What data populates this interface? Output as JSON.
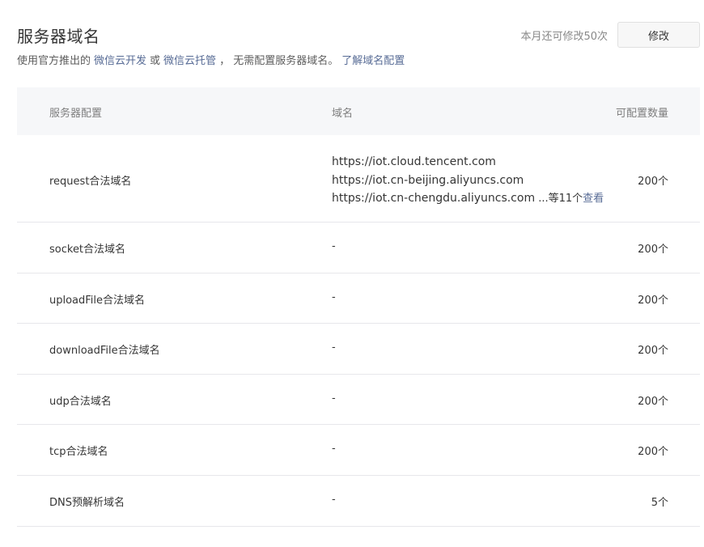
{
  "header": {
    "title": "服务器域名",
    "subtitle_prefix": "使用官方推出的",
    "link_cloud_dev": "微信云开发",
    "subtitle_or": "或",
    "link_cloud_hosting": "微信云托管",
    "subtitle_suffix": "，  无需配置服务器域名。",
    "link_learn": "了解域名配置",
    "quota_text": "本月还可修改50次",
    "modify_label": "修改"
  },
  "table": {
    "columns": [
      "服务器配置",
      "域名",
      "可配置数量"
    ],
    "rows": [
      {
        "name": "request合法域名",
        "domains": [
          "https://iot.cloud.tencent.com",
          "https://iot.cn-beijing.aliyuncs.com",
          "https://iot.cn-chengdu.aliyuncs.com"
        ],
        "more": " ...等11个",
        "view": "查看",
        "count": "200个"
      },
      {
        "name": "socket合法域名",
        "domain": "-",
        "count": "200个"
      },
      {
        "name": "uploadFile合法域名",
        "domain": "-",
        "count": "200个"
      },
      {
        "name": "downloadFile合法域名",
        "domain": "-",
        "count": "200个"
      },
      {
        "name": "udp合法域名",
        "domain": "-",
        "count": "200个"
      },
      {
        "name": "tcp合法域名",
        "domain": "-",
        "count": "200个"
      },
      {
        "name": "DNS预解析域名",
        "domain": "-",
        "count": "5个"
      }
    ]
  }
}
